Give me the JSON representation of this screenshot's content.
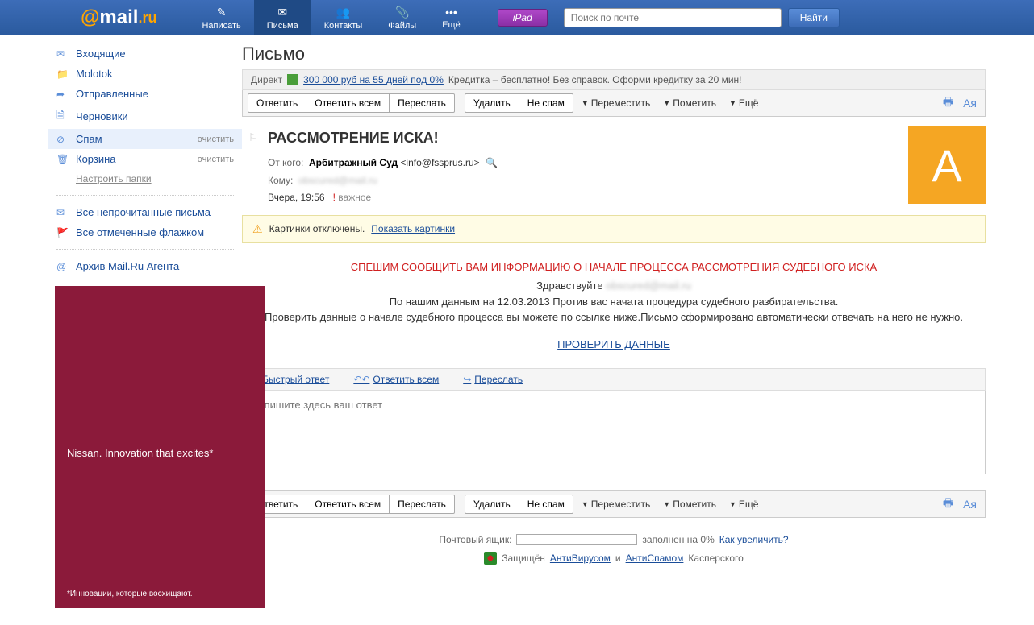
{
  "header": {
    "nav": [
      {
        "icon": "✎",
        "label": "Написать"
      },
      {
        "icon": "✉",
        "label": "Письма"
      },
      {
        "icon": "👥",
        "label": "Контакты"
      },
      {
        "icon": "📎",
        "label": "Файлы"
      },
      {
        "icon": "•••",
        "label": "Ещё"
      }
    ],
    "ipad": "iPad",
    "search_placeholder": "Поиск по почте",
    "search_btn": "Найти"
  },
  "sidebar": {
    "folders": [
      {
        "icon": "✉",
        "name": "Входящие"
      },
      {
        "icon": "📁",
        "name": "Molotok"
      },
      {
        "icon": "➦",
        "name": "Отправленные"
      },
      {
        "icon": "🗎",
        "name": "Черновики"
      },
      {
        "icon": "⊘",
        "name": "Спам",
        "action": "очистить",
        "active": true
      },
      {
        "icon": "🗑",
        "name": "Корзина",
        "action": "очистить"
      }
    ],
    "settings": "Настроить папки",
    "links": [
      {
        "icon": "✉",
        "name": "Все непрочитанные письма"
      },
      {
        "icon": "🚩",
        "name": "Все отмеченные флажком"
      }
    ],
    "archive": {
      "icon": "@",
      "name": "Архив Mail.Ru Агента"
    },
    "ad": {
      "text": "Nissan. Innovation that excites*",
      "footnote": "*Инновации, которые восхищают."
    }
  },
  "main": {
    "title": "Письмо",
    "direct": {
      "label": "Директ",
      "link": "300 000 руб на 55 дней под 0%",
      "desc": "Кредитка – бесплатно! Без справок. Оформи кредитку за 20 мин!"
    },
    "toolbar": {
      "reply": "Ответить",
      "reply_all": "Ответить всем",
      "forward": "Переслать",
      "delete": "Удалить",
      "not_spam": "Не спам",
      "move": "Переместить",
      "mark": "Пометить",
      "more": "Ещё"
    },
    "message": {
      "subject": "РАССМОТРЕНИЕ ИСКА!",
      "from_label": "От кого:",
      "from_name": "Арбитражный Суд",
      "from_email": "<info@fssprus.ru>",
      "to_label": "Кому:",
      "date": "Вчера, 19:56",
      "important": "важное",
      "avatar_letter": "А",
      "img_notice": "Картинки отключены.",
      "img_link": "Показать картинки",
      "body": {
        "red": "СПЕШИМ СООБЩИТЬ ВАМ ИНФОРМАЦИЮ О НАЧАЛЕ ПРОЦЕССА РАССМОТРЕНИЯ СУДЕБНОГО ИСКА",
        "greeting": "Здравствуйте",
        "line1": "По нашим данным на 12.03.2013  Против вас начата процедура судебного разбирательства.",
        "line2": "Проверить данные о начале судебного процесса вы можете по ссылке ниже.Письмо сформировано автоматически отвечать на него не нужно.",
        "link": "ПРОВЕРИТЬ ДАННЫЕ"
      }
    },
    "quick_actions": {
      "quick_reply": "Быстрый ответ",
      "reply_all": "Ответить всем",
      "forward": "Переслать"
    },
    "reply_placeholder": "Напишите здесь ваш ответ",
    "footer": {
      "quota_label": "Почтовый ящик:",
      "quota_text": "заполнен на 0%",
      "quota_link": "Как увеличить?",
      "protected": "Защищён",
      "antivirus": "АнтиВирусом",
      "and": "и",
      "antispam": "АнтиСпамом",
      "kaspersky": "Касперского"
    }
  }
}
